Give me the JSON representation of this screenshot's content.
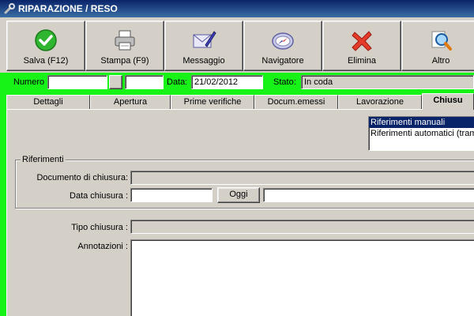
{
  "window": {
    "title": "RIPARAZIONE / RESO",
    "title_icon": "wrench-icon"
  },
  "toolbar": {
    "buttons": [
      {
        "label": "Salva (F12)",
        "icon": "check-icon"
      },
      {
        "label": "Stampa (F9)",
        "icon": "printer-icon"
      },
      {
        "label": "Messaggio",
        "icon": "envelope-pen-icon"
      },
      {
        "label": "Navigatore",
        "icon": "compass-icon"
      },
      {
        "label": "Elimina",
        "icon": "delete-x-icon"
      },
      {
        "label": "Altro",
        "icon": "magnifier-icon"
      }
    ]
  },
  "header": {
    "numero_label": "Numero",
    "numero_value": "",
    "numero_suffix_value": "",
    "data_label": "Data",
    "data_value": "21/02/2012",
    "stato_label": "Stato",
    "stato_value": "In coda"
  },
  "tabs": [
    {
      "label": "Dettagli",
      "active": false
    },
    {
      "label": "Apertura",
      "active": false
    },
    {
      "label": "Prime verifiche",
      "active": false
    },
    {
      "label": "Docum.emessi",
      "active": false
    },
    {
      "label": "Lavorazione",
      "active": false
    },
    {
      "label": "Chiusu",
      "active": true
    }
  ],
  "riferimenti_list": {
    "items": [
      {
        "label": "Riferimenti manuali",
        "selected": true
      },
      {
        "label": "Riferimenti automatici (tramit",
        "selected": false
      }
    ]
  },
  "riferimenti_group": {
    "title": "Riferimenti",
    "documento_label": "Documento di chiusura:",
    "documento_value": "",
    "data_chiusura_label": "Data chiusura :",
    "data_chiusura_value": "",
    "oggi_button": "Oggi",
    "data_extra_value": ""
  },
  "tipo_chiusura": {
    "label": "Tipo chiusura :",
    "value": ""
  },
  "annotazioni": {
    "label": "Annotazioni :",
    "value": ""
  },
  "colors": {
    "green_bar": "#17f217",
    "title_blue": "#0a246a",
    "face": "#d4d0c8",
    "selection": "#0a246a"
  }
}
